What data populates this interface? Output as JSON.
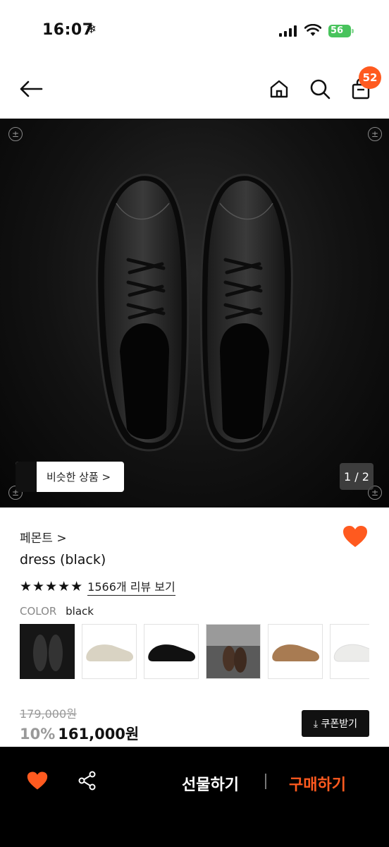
{
  "status_bar": {
    "time": "16:07",
    "battery": "56"
  },
  "header": {
    "cart_count": "52"
  },
  "gallery": {
    "similar_label": "비슷한 상품 >",
    "counter": "1 / 2"
  },
  "product": {
    "brand": "페몬트 >",
    "name": "dress (black)",
    "rating_stars": "★★★★★",
    "reviews_link": "1566개 리뷰 보기",
    "color_label": "COLOR",
    "color_value": "black",
    "color_options": [
      "black",
      "beige",
      "black-suede",
      "brown-lifestyle",
      "tan",
      "white"
    ],
    "original_price": "179,000원",
    "discount": "10%",
    "sale_price": "161,000원",
    "coupon_label": "⤓ 쿠폰받기"
  },
  "bottom_bar": {
    "gift_label": "선물하기",
    "buy_label": "구매하기"
  },
  "colors": {
    "accent": "#ff5a1f",
    "dark": "#000000"
  }
}
